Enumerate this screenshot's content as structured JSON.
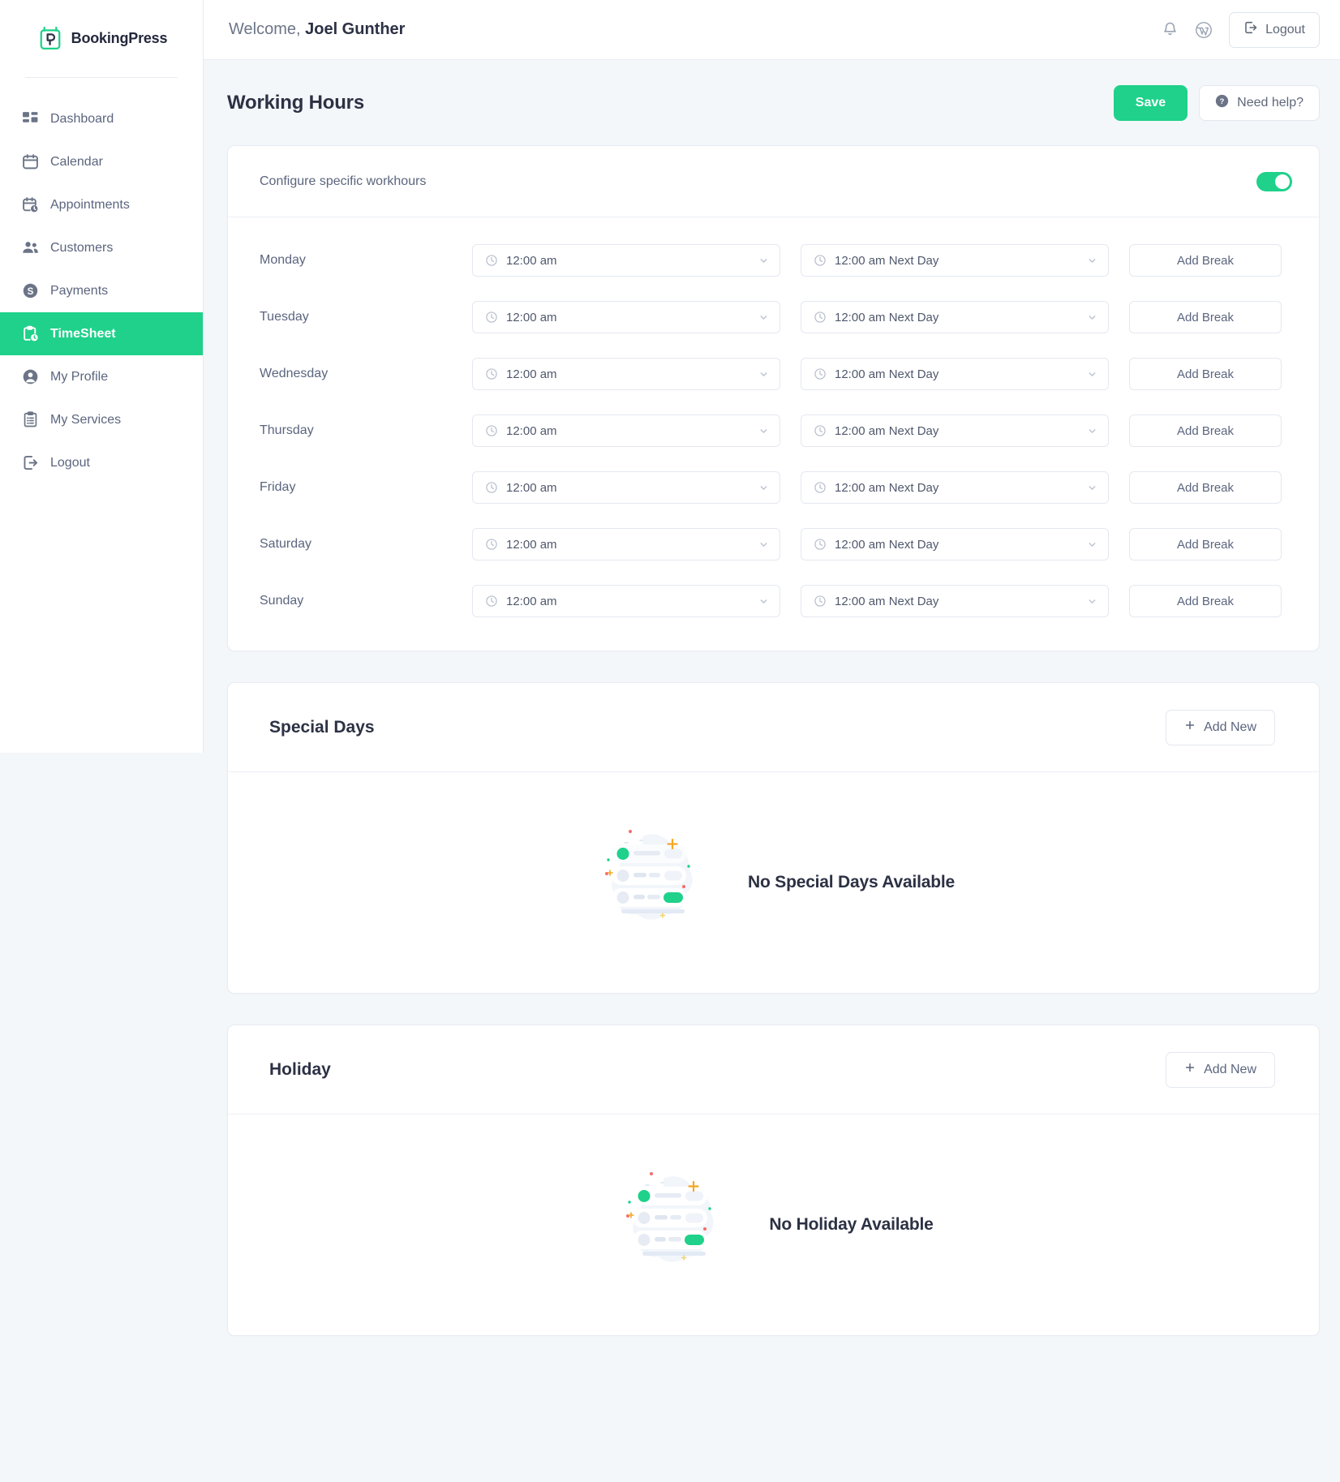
{
  "brand": {
    "name": "BookingPress",
    "logo_icon": "bookingpress-logo-icon",
    "accent": "#1fd18a"
  },
  "sidebar": {
    "items": [
      {
        "label": "Dashboard",
        "icon": "dashboard-icon",
        "active": false
      },
      {
        "label": "Calendar",
        "icon": "calendar-icon",
        "active": false
      },
      {
        "label": "Appointments",
        "icon": "appointments-icon",
        "active": false
      },
      {
        "label": "Customers",
        "icon": "customers-icon",
        "active": false
      },
      {
        "label": "Payments",
        "icon": "payments-icon",
        "active": false
      },
      {
        "label": "TimeSheet",
        "icon": "timesheet-icon",
        "active": true
      },
      {
        "label": "My Profile",
        "icon": "profile-icon",
        "active": false
      },
      {
        "label": "My Services",
        "icon": "services-icon",
        "active": false
      },
      {
        "label": "Logout",
        "icon": "logout-icon",
        "active": false
      }
    ]
  },
  "topbar": {
    "welcome_prefix": "Welcome,",
    "user_name": "Joel Gunther",
    "bell_icon": "notification-bell-icon",
    "wordpress_icon": "wordpress-icon",
    "logout_label": "Logout",
    "logout_icon": "logout-icon"
  },
  "page": {
    "title": "Working Hours",
    "save_label": "Save",
    "help_label": "Need help?",
    "help_icon": "question-circle-icon"
  },
  "working_hours": {
    "configure_label": "Configure specific workhours",
    "toggle_on": true,
    "break_label": "Add Break",
    "clock_icon": "clock-icon",
    "chevron_icon": "chevron-down-icon",
    "rows": [
      {
        "day": "Monday",
        "start": "12:00 am",
        "end": "12:00 am Next Day",
        "break_label": "Add Break"
      },
      {
        "day": "Tuesday",
        "start": "12:00 am",
        "end": "12:00 am Next Day",
        "break_label": "Add Break"
      },
      {
        "day": "Wednesday",
        "start": "12:00 am",
        "end": "12:00 am Next Day",
        "break_label": "Add Break"
      },
      {
        "day": "Thursday",
        "start": "12:00 am",
        "end": "12:00 am Next Day",
        "break_label": "Add Break"
      },
      {
        "day": "Friday",
        "start": "12:00 am",
        "end": "12:00 am Next Day",
        "break_label": "Add Break"
      },
      {
        "day": "Saturday",
        "start": "12:00 am",
        "end": "12:00 am Next Day",
        "break_label": "Add Break"
      },
      {
        "day": "Sunday",
        "start": "12:00 am",
        "end": "12:00 am Next Day",
        "break_label": "Add Break"
      }
    ]
  },
  "special_days": {
    "title": "Special Days",
    "add_label": "Add New",
    "add_icon": "plus-icon",
    "empty_text": "No Special Days Available",
    "empty_illustration": "empty-list-illustration"
  },
  "holiday": {
    "title": "Holiday",
    "add_label": "Add New",
    "add_icon": "plus-icon",
    "empty_text": "No Holiday Available",
    "empty_illustration": "empty-list-illustration"
  }
}
